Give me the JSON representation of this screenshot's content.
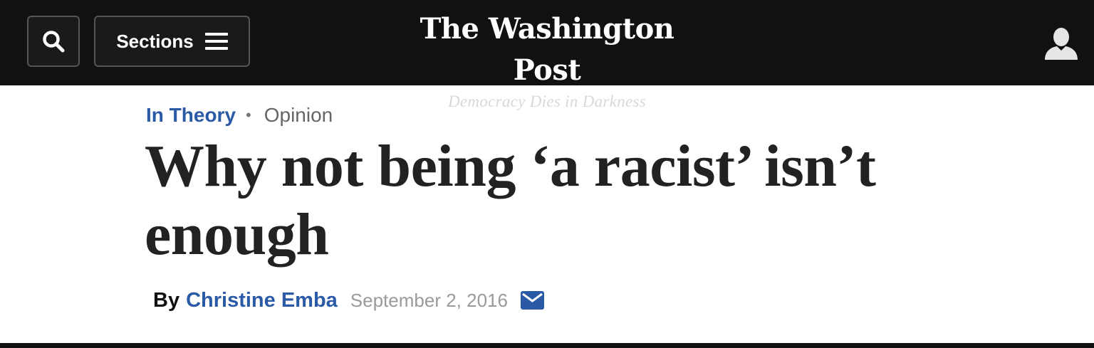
{
  "header": {
    "search_icon": "search-icon",
    "sections_label": "Sections",
    "menu_icon": "hamburger-menu-icon",
    "logo_text": "The Washington Post",
    "tagline": "Democracy Dies in Darkness",
    "user_icon": "user-account-icon"
  },
  "article": {
    "kicker_section": "In Theory",
    "kicker_separator": "•",
    "kicker_type": "Opinion",
    "headline": "Why not being ‘a racist’ isn’t enough",
    "byline_prefix": "By",
    "author": "Christine Emba",
    "date": "September 2, 2016",
    "share_icon": "email-envelope-icon"
  },
  "colors": {
    "header_bg": "#111111",
    "accent_blue": "#2a5aa6",
    "headline_text": "#222222",
    "date_text": "#9a9a9a"
  }
}
